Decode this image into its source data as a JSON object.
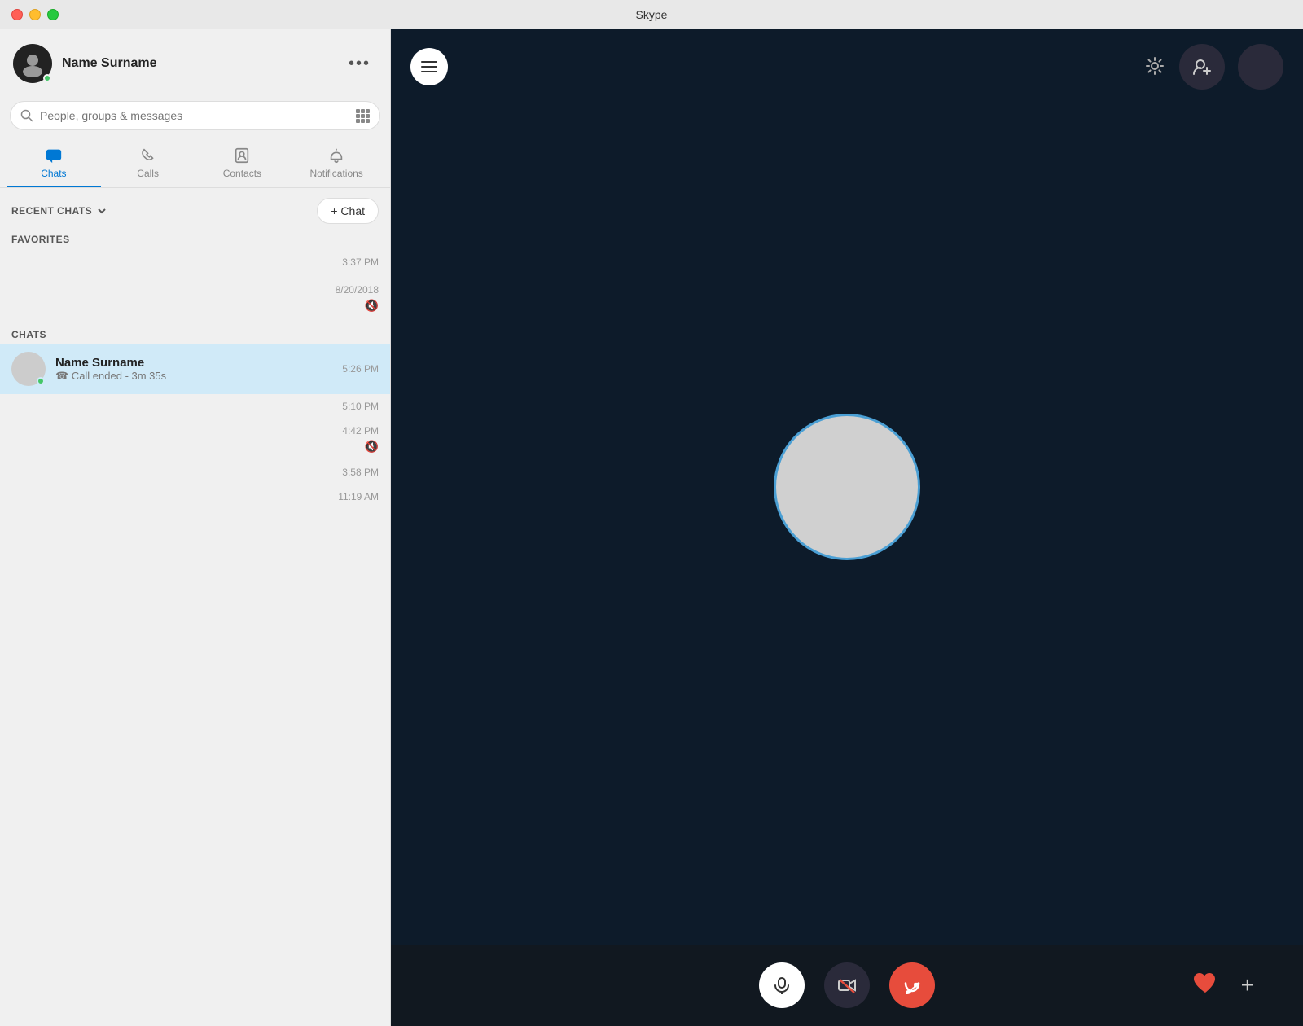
{
  "titlebar": {
    "title": "Skype"
  },
  "sidebar": {
    "profile": {
      "name": "Name Surname",
      "more_label": "•••",
      "online": true
    },
    "search": {
      "placeholder": "People, groups & messages"
    },
    "nav": {
      "tabs": [
        {
          "id": "chats",
          "label": "Chats",
          "active": true
        },
        {
          "id": "calls",
          "label": "Calls",
          "active": false
        },
        {
          "id": "contacts",
          "label": "Contacts",
          "active": false
        },
        {
          "id": "notifications",
          "label": "Notifications",
          "active": false
        }
      ]
    },
    "recent_chats": {
      "label": "RECENT CHATS",
      "new_chat_label": "+ Chat"
    },
    "favorites": {
      "label": "FAVORITES",
      "items": [
        {
          "time": "3:37 PM"
        }
      ]
    },
    "chats": {
      "label": "CHATS",
      "items": [
        {
          "name": "Name Surname",
          "preview": "☎ Call ended - 3m 35s",
          "time": "5:26 PM",
          "active": true,
          "online": true
        },
        {
          "name": "",
          "preview": "",
          "time": "5:10 PM",
          "active": false,
          "online": false
        },
        {
          "name": "",
          "preview": "",
          "time": "4:42 PM",
          "active": false,
          "online": false,
          "muted": true
        },
        {
          "name": "",
          "preview": "",
          "time": "3:58 PM",
          "active": false,
          "online": false
        },
        {
          "name": "",
          "preview": "",
          "time": "11:19 AM",
          "active": false,
          "online": false
        }
      ]
    }
  },
  "call_panel": {
    "header": {
      "menu_label": "menu",
      "settings_label": "settings",
      "add_person_label": "add person"
    },
    "controls": {
      "mic_label": "microphone",
      "video_label": "video",
      "end_call_label": "end call",
      "heart_label": "♥",
      "plus_label": "+"
    }
  },
  "favorites_date": "8/20/2018"
}
